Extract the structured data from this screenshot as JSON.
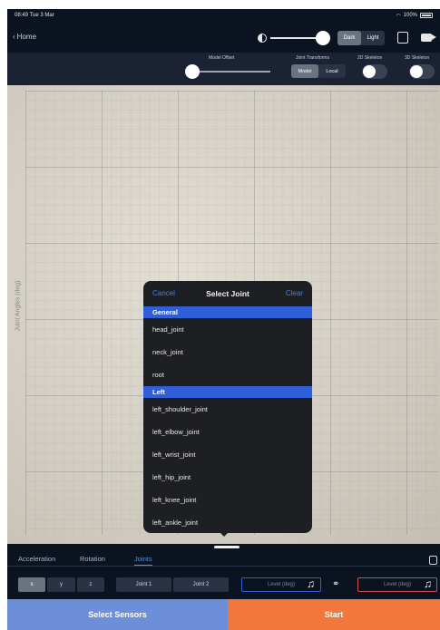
{
  "status_bar": {
    "time": "08:49",
    "date": "Tue 3 Mar",
    "battery": "100%"
  },
  "nav": {
    "back_label": "Home",
    "theme_options": [
      "Dark",
      "Light"
    ],
    "theme_selected": "Dark"
  },
  "controls": {
    "model_offset_label": "Model Offset",
    "joint_transforms_label": "Joint Transforms",
    "joint_transforms_options": [
      "Model",
      "Local"
    ],
    "joint_transforms_selected": "Model",
    "skeleton_2d_label": "2D Skeleton",
    "skeleton_3d_label": "3D Skeleton"
  },
  "chart": {
    "y_axis_label": "Joint Angles (deg)"
  },
  "popup": {
    "cancel_label": "Cancel",
    "title": "Select Joint",
    "clear_label": "Clear",
    "sections": [
      {
        "name": "General",
        "items": [
          "head_joint",
          "neck_joint",
          "root"
        ]
      },
      {
        "name": "Left",
        "items": [
          "left_shoulder_joint",
          "left_elbow_joint",
          "left_wrist_joint",
          "left_hip_joint",
          "left_knee_joint",
          "left_ankle_joint"
        ]
      }
    ]
  },
  "tabs": {
    "items": [
      "Acceleration",
      "Rotation",
      "Joints"
    ],
    "selected": "Joints"
  },
  "toolbar": {
    "axis_options": [
      "x",
      "y",
      "z"
    ],
    "axis_selected": "x",
    "joint_options": [
      "Joint 1",
      "Joint 2"
    ],
    "level_placeholder_1": "Level (deg)",
    "level_placeholder_2": "Level (deg)"
  },
  "buttons": {
    "select_sensors": "Select Sensors",
    "start": "Start"
  },
  "colors": {
    "accent": "#2f5fd8",
    "start": "#f0783c",
    "sensors": "#6d8ed8",
    "background": "#0b1220"
  },
  "icons": [
    "back-chevron-icon",
    "brightness-icon",
    "export-icon",
    "video-camera-icon",
    "music-note-icon",
    "link-icon",
    "battery-icon",
    "wifi-icon",
    "panel-toggle-icon"
  ]
}
